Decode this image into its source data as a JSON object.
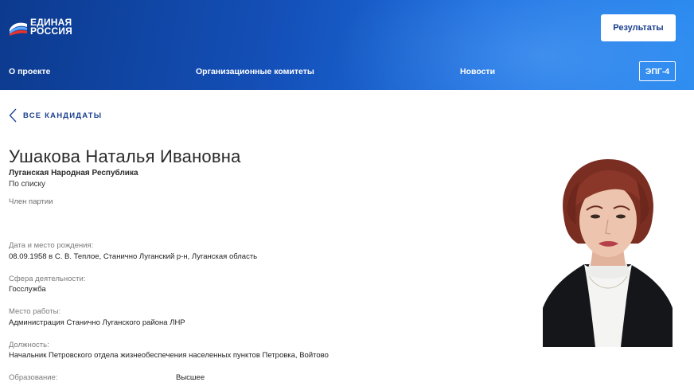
{
  "header": {
    "logo_line1": "ЕДИНАЯ",
    "logo_line2": "РОССИЯ",
    "results_button": "Результаты",
    "nav": [
      "О проекте",
      "Организационные комитеты",
      "Новости"
    ],
    "epg_button": "ЭПГ-4"
  },
  "back_link": "ВСЕ КАНДИДАТЫ",
  "candidate": {
    "name": "Ушакова Наталья Ивановна",
    "region": "Луганская Народная Республика",
    "list": "По списку",
    "membership": "Член партии"
  },
  "fields": [
    {
      "label": "Дата и место рождения:",
      "value": "08.09.1958 в С. В. Теплое, Станично Луганский р-н, Луганская область"
    },
    {
      "label": "Сфера деятельности:",
      "value": "Госслужба"
    },
    {
      "label": "Место работы:",
      "value": "Администрация Станично Луганского района ЛНР"
    },
    {
      "label": "Должность:",
      "value": "Начальник Петровского отдела жизнеобеспечения населенных пунктов Петровка, Войтово"
    },
    {
      "label": "Образование:",
      "value": "Высшее"
    }
  ],
  "colors": {
    "header_dark": "#0c3a8e",
    "header_light": "#2a8af0",
    "accent": "#1a3f8f"
  }
}
